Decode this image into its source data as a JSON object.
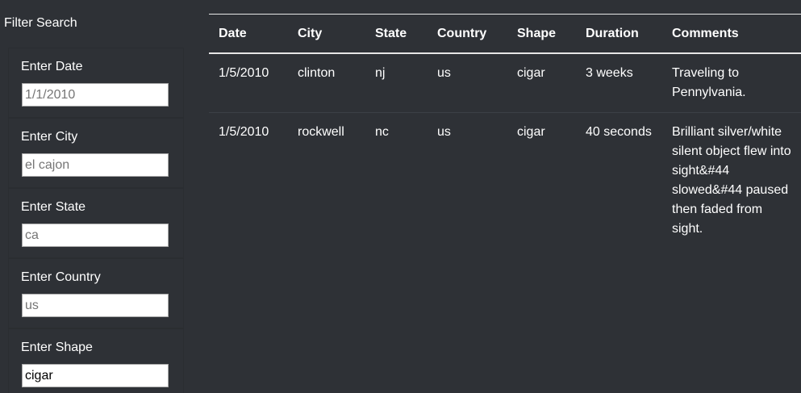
{
  "sidebar": {
    "heading": "Filter Search",
    "filters": [
      {
        "label": "Enter Date",
        "placeholder": "1/1/2010",
        "value": ""
      },
      {
        "label": "Enter City",
        "placeholder": "el cajon",
        "value": ""
      },
      {
        "label": "Enter State",
        "placeholder": "ca",
        "value": ""
      },
      {
        "label": "Enter Country",
        "placeholder": "us",
        "value": ""
      },
      {
        "label": "Enter Shape",
        "placeholder": "",
        "value": "cigar"
      }
    ]
  },
  "table": {
    "columns": [
      "Date",
      "City",
      "State",
      "Country",
      "Shape",
      "Duration",
      "Comments"
    ],
    "rows": [
      {
        "date": "1/5/2010",
        "city": "clinton",
        "state": "nj",
        "country": "us",
        "shape": "cigar",
        "duration": "3 weeks",
        "comments": "Traveling to Pennylvania."
      },
      {
        "date": "1/5/2010",
        "city": "rockwell",
        "state": "nc",
        "country": "us",
        "shape": "cigar",
        "duration": "40 seconds",
        "comments": "Brilliant silver/white silent object flew into sight&#44 slowed&#44 paused then faded from sight."
      }
    ]
  }
}
